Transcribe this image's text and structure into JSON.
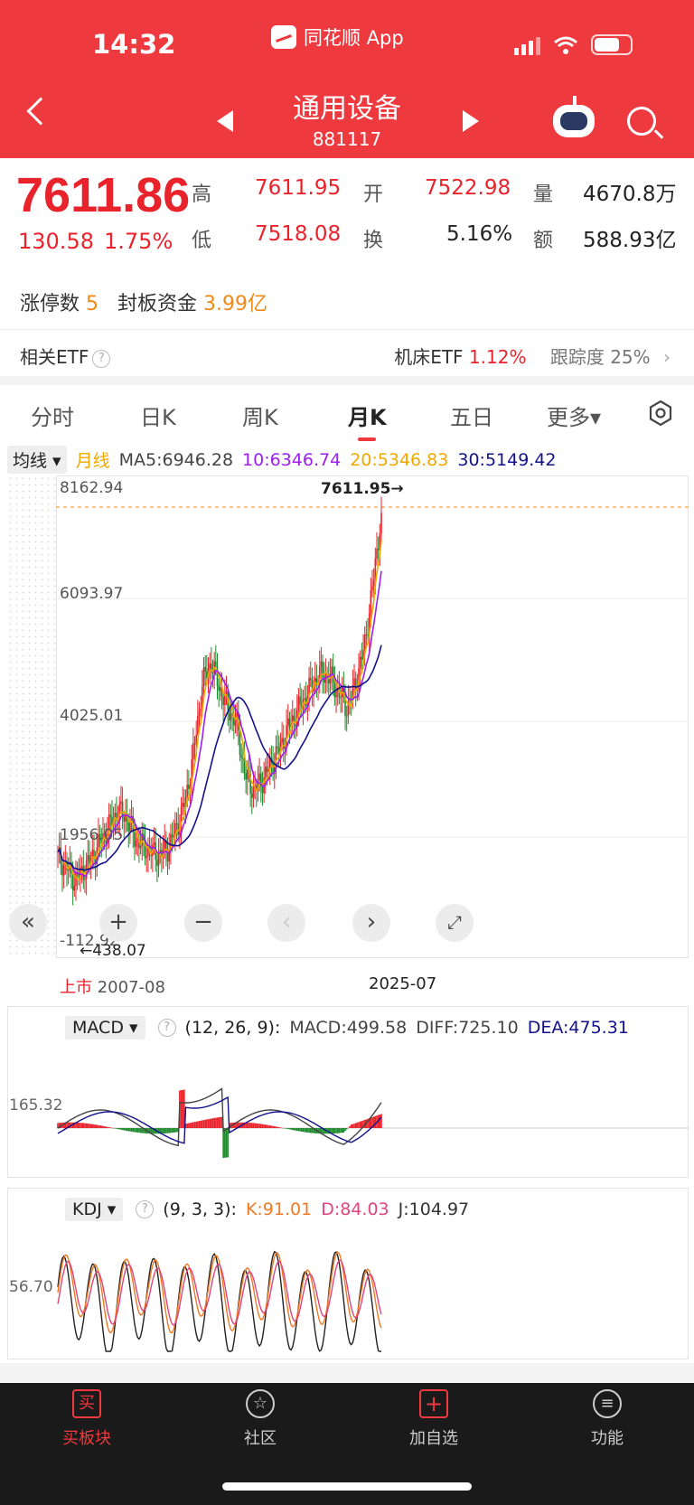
{
  "status": {
    "time": "14:32",
    "app": "同花顺 App"
  },
  "header": {
    "title": "通用设备",
    "code": "881117"
  },
  "quote": {
    "price": "7611.86",
    "change": "130.58",
    "change_pct": "1.75%",
    "high_label": "高",
    "high": "7611.95",
    "low_label": "低",
    "low": "7518.08",
    "open_label": "开",
    "open": "7522.98",
    "turnover_label": "换",
    "turnover": "5.16%",
    "volume_label": "量",
    "volume": "4670.8万",
    "amount_label": "额",
    "amount": "588.93亿"
  },
  "limit": {
    "count_label": "涨停数",
    "count": "5",
    "fund_label": "封板资金",
    "fund": "3.99亿"
  },
  "etf": {
    "label": "相关ETF",
    "name": "机床ETF",
    "change": "1.12%",
    "track_label": "跟踪度",
    "track": "25%"
  },
  "tabs": [
    "分时",
    "日K",
    "周K",
    "月K",
    "五日",
    "更多▾"
  ],
  "ma": {
    "select": "均线 ▾",
    "type": "月线",
    "ma5": "MA5:6946.28",
    "ma10": "10:6346.74",
    "ma20": "20:5346.83",
    "ma30": "30:5149.42"
  },
  "chart_data": {
    "type": "candlestick",
    "period": "monthly",
    "y_ticks": [
      "8162.94",
      "6093.97",
      "4025.01",
      "1956.05",
      "-112.92"
    ],
    "max_label": "7611.95→",
    "min_label": "←438.07",
    "x_start_tag": "上市",
    "x_start": "2007-08",
    "x_end": "2025-07",
    "close": [
      900,
      700,
      450,
      650,
      900,
      1200,
      1500,
      1800,
      1700,
      1300,
      1100,
      1000,
      950,
      1100,
      1500,
      2000,
      3000,
      4300,
      4700,
      4200,
      3800,
      3500,
      2500,
      2200,
      2400,
      2700,
      3000,
      3400,
      3700,
      4000,
      4300,
      4500,
      4400,
      4100,
      3800,
      4300,
      5000,
      6200,
      7611
    ]
  },
  "macd": {
    "select": "MACD ▾",
    "params": "(12, 26, 9):",
    "macd": "MACD:499.58",
    "diff": "DIFF:725.10",
    "dea": "DEA:475.31",
    "ylabel": "165.32"
  },
  "kdj": {
    "select": "KDJ ▾",
    "params": "(9, 3, 3):",
    "k": "K:91.01",
    "d": "D:84.03",
    "j": "J:104.97",
    "ylabel": "56.70"
  },
  "tabbar": [
    "买板块",
    "社区",
    "加自选",
    "功能"
  ],
  "colors": {
    "accent": "#ee3a3f",
    "up": "#e8232b",
    "down": "#1f8a2e",
    "ma5": "#f0a800",
    "ma10": "#9b1ff0",
    "ma30": "#12128c"
  }
}
